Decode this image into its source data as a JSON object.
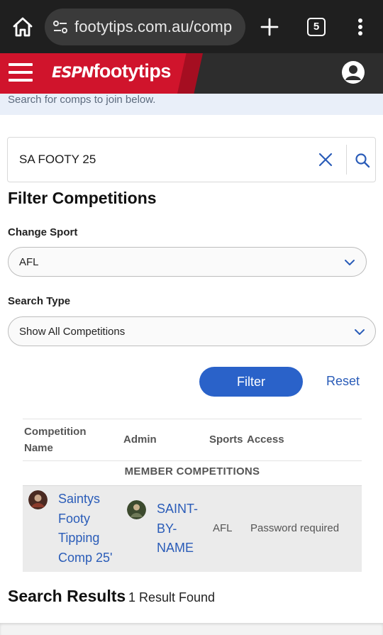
{
  "browser": {
    "url": "footytips.com.au/comp",
    "tab_count": "5"
  },
  "header": {
    "logo_espn": "ESPN",
    "logo_footytips": "footytips",
    "brand_color": "#d0142c"
  },
  "banner": {
    "text": "Search for comps to join below."
  },
  "search": {
    "value": "SA FOOTY 25"
  },
  "filters": {
    "heading": "Filter Competitions",
    "sport_label": "Change Sport",
    "sport_value": "AFL",
    "type_label": "Search Type",
    "type_value": "Show All Competitions",
    "filter_button": "Filter",
    "reset_button": "Reset"
  },
  "table": {
    "headers": {
      "name_line1": "Competition",
      "name_line2": "Name",
      "admin": "Admin",
      "sports": "Sports",
      "access": "Access"
    },
    "group_label": "MEMBER COMPETITIONS",
    "rows": [
      {
        "name_lines": [
          "Saintys",
          "Footy",
          "Tipping",
          "Comp 25'"
        ],
        "admin_lines": [
          "SAINT-",
          "BY-",
          "NAME"
        ],
        "sport": "AFL",
        "access": "Password required"
      }
    ]
  },
  "results": {
    "title": "Search Results",
    "count_text": "1 Result Found"
  }
}
